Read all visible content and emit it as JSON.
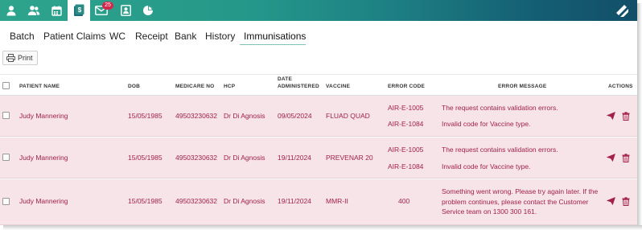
{
  "topbar": {
    "icons": [
      "user-icon",
      "users-icon",
      "calendar-icon",
      "claims-icon",
      "messages-icon",
      "address-book-icon",
      "pie-chart-icon"
    ],
    "messages_badge": "25",
    "logo": "brand-logo"
  },
  "tabs": [
    {
      "label": "Batch"
    },
    {
      "label": "Patient Claims"
    },
    {
      "label": "WC"
    },
    {
      "label": "Receipt"
    },
    {
      "label": "Bank"
    },
    {
      "label": "History"
    },
    {
      "label": "Immunisations"
    }
  ],
  "active_tab": "Immunisations",
  "print_label": "Print",
  "table": {
    "headers": {
      "patient_name": "PATIENT NAME",
      "dob": "DOB",
      "medicare_no": "MEDICARE NO",
      "hcp": "HCP",
      "date_administered_1": "DATE",
      "date_administered_2": "ADMINISTERED",
      "vaccine": "VACCINE",
      "error_code": "ERROR CODE",
      "error_message": "ERROR MESSAGE",
      "actions": "ACTIONS"
    },
    "rows": [
      {
        "patient_name": "Judy Mannering",
        "dob": "15/05/1985",
        "medicare_no": "49503230632",
        "hcp": "Dr Di Agnosis",
        "date_administered": "09/05/2024",
        "vaccine": "FLUAD QUAD",
        "error_code_1": "AIR-E-1005",
        "error_code_2": "AIR-E-1084",
        "error_message_1": "The request contains validation errors.",
        "error_message_2": "Invalid code for Vaccine type."
      },
      {
        "patient_name": "Judy Mannering",
        "dob": "15/05/1985",
        "medicare_no": "49503230632",
        "hcp": "Dr Di Agnosis",
        "date_administered": "19/11/2024",
        "vaccine": "PREVENAR 20",
        "error_code_1": "AIR-E-1005",
        "error_code_2": "AIR-E-1084",
        "error_message_1": "The request contains validation errors.",
        "error_message_2": "Invalid code for Vaccine type."
      },
      {
        "patient_name": "Judy Mannering",
        "dob": "15/05/1985",
        "medicare_no": "49503230632",
        "hcp": "Dr Di Agnosis",
        "date_administered": "19/11/2024",
        "vaccine": "MMR-II",
        "error_code_1": "400",
        "error_message_1": "Something went wrong. Please try again later. If the problem continues, please contact the Customer Service team on 1300 300 161."
      }
    ],
    "row_actions": [
      "send-icon",
      "trash-icon"
    ]
  },
  "colors": {
    "topbar_start": "#2ea48c",
    "topbar_end": "#124f69",
    "error_row_bg": "#f6e4e8",
    "error_text": "#a2214a",
    "badge": "#d0284c"
  }
}
